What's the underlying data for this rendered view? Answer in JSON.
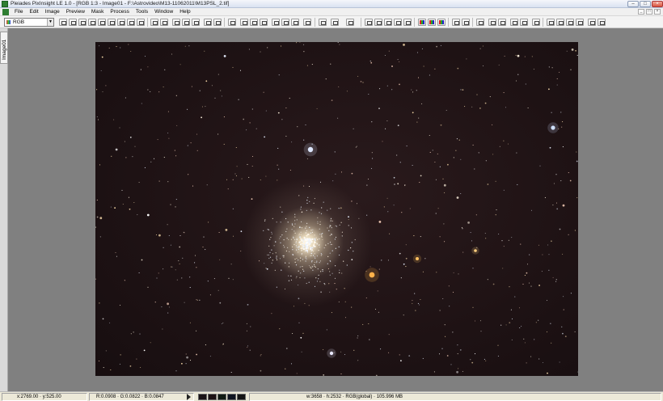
{
  "window": {
    "title": "Pleiades PixInsight LE 1.0 - [RGB 1:3 - Image01 - F:\\Astrovideo\\M13-11062011\\M13PSL_2.tif]",
    "minimize_icon": "minimize-icon",
    "maximize_icon": "maximize-icon",
    "close_icon": "close-icon"
  },
  "menu": {
    "items": [
      "File",
      "Edit",
      "Image",
      "Preview",
      "Mask",
      "Process",
      "Tools",
      "Window",
      "Help"
    ]
  },
  "toolbar": {
    "channel_value": "RGB"
  },
  "image_window": {
    "tab_label": "Image01"
  },
  "status": {
    "coords": "x:2769.00 · y:525.00",
    "rgb": "R:0.0908 · G:0.0822 · B:0.0847",
    "info": "w:3658 · h:2532 · RGB(global) · 105.996 MB",
    "swatch_colors": [
      "#1a1316",
      "#1c1214",
      "#101a12",
      "#0f1420",
      "#141414"
    ]
  },
  "colors": {
    "workspace": "#808080",
    "sky": "#1e1214"
  }
}
